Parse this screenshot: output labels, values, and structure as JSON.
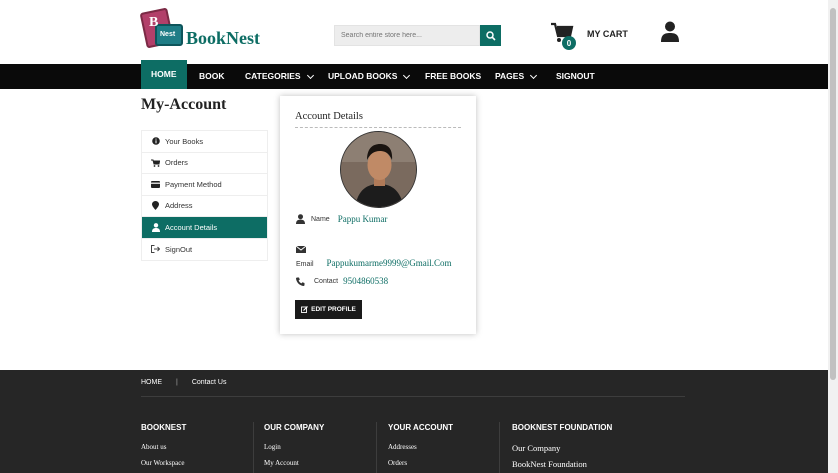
{
  "brand": {
    "name": "BookNest",
    "badge_letter": "B",
    "badge_tag": "Nest"
  },
  "search": {
    "placeholder": "Search entire store here..."
  },
  "cart": {
    "label": "MY CART",
    "count": "0"
  },
  "nav": {
    "items": [
      {
        "label": "HOME",
        "active": true
      },
      {
        "label": "BOOK"
      },
      {
        "label": "CATEGORIES",
        "dropdown": true
      },
      {
        "label": "UPLOAD BOOKS",
        "dropdown": true
      },
      {
        "label": "FREE BOOKS"
      },
      {
        "label": "PAGES",
        "dropdown": true
      },
      {
        "label": "SIGNOUT"
      }
    ]
  },
  "page": {
    "title": "My-Account"
  },
  "sidebar": {
    "items": [
      {
        "label": "Your Books",
        "icon": "info-circle-icon"
      },
      {
        "label": "Orders",
        "icon": "cart-icon"
      },
      {
        "label": "Payment Method",
        "icon": "credit-card-icon"
      },
      {
        "label": "Address",
        "icon": "map-marker-icon"
      },
      {
        "label": "Account Details",
        "icon": "user-icon",
        "active": true
      },
      {
        "label": "SignOut",
        "icon": "sign-out-icon"
      }
    ]
  },
  "account": {
    "title": "Account Details",
    "name_label": "Name",
    "name_value": "Pappu Kumar",
    "email_label": "Email",
    "email_value": "Pappukumarme9999@Gmail.Com",
    "contact_label": "Contact",
    "contact_value": "9504860538",
    "edit_label": "EDIT PROFILE"
  },
  "footer": {
    "links": [
      "HOME",
      "Contact Us"
    ],
    "columns": [
      {
        "title": "BOOKNEST",
        "links": [
          "About us",
          "Our Workspace"
        ]
      },
      {
        "title": "OUR COMPANY",
        "links": [
          "Login",
          "My Account"
        ]
      },
      {
        "title": "YOUR ACCOUNT",
        "links": [
          "Addresses",
          "Orders"
        ]
      },
      {
        "title": "BOOKNEST FOUNDATION",
        "links": [
          "Our Company",
          "BookNest Foundation"
        ]
      }
    ]
  },
  "colors": {
    "accent": "#0d6d64",
    "nav_bg": "#0a0a0a",
    "footer_bg": "#262626"
  }
}
